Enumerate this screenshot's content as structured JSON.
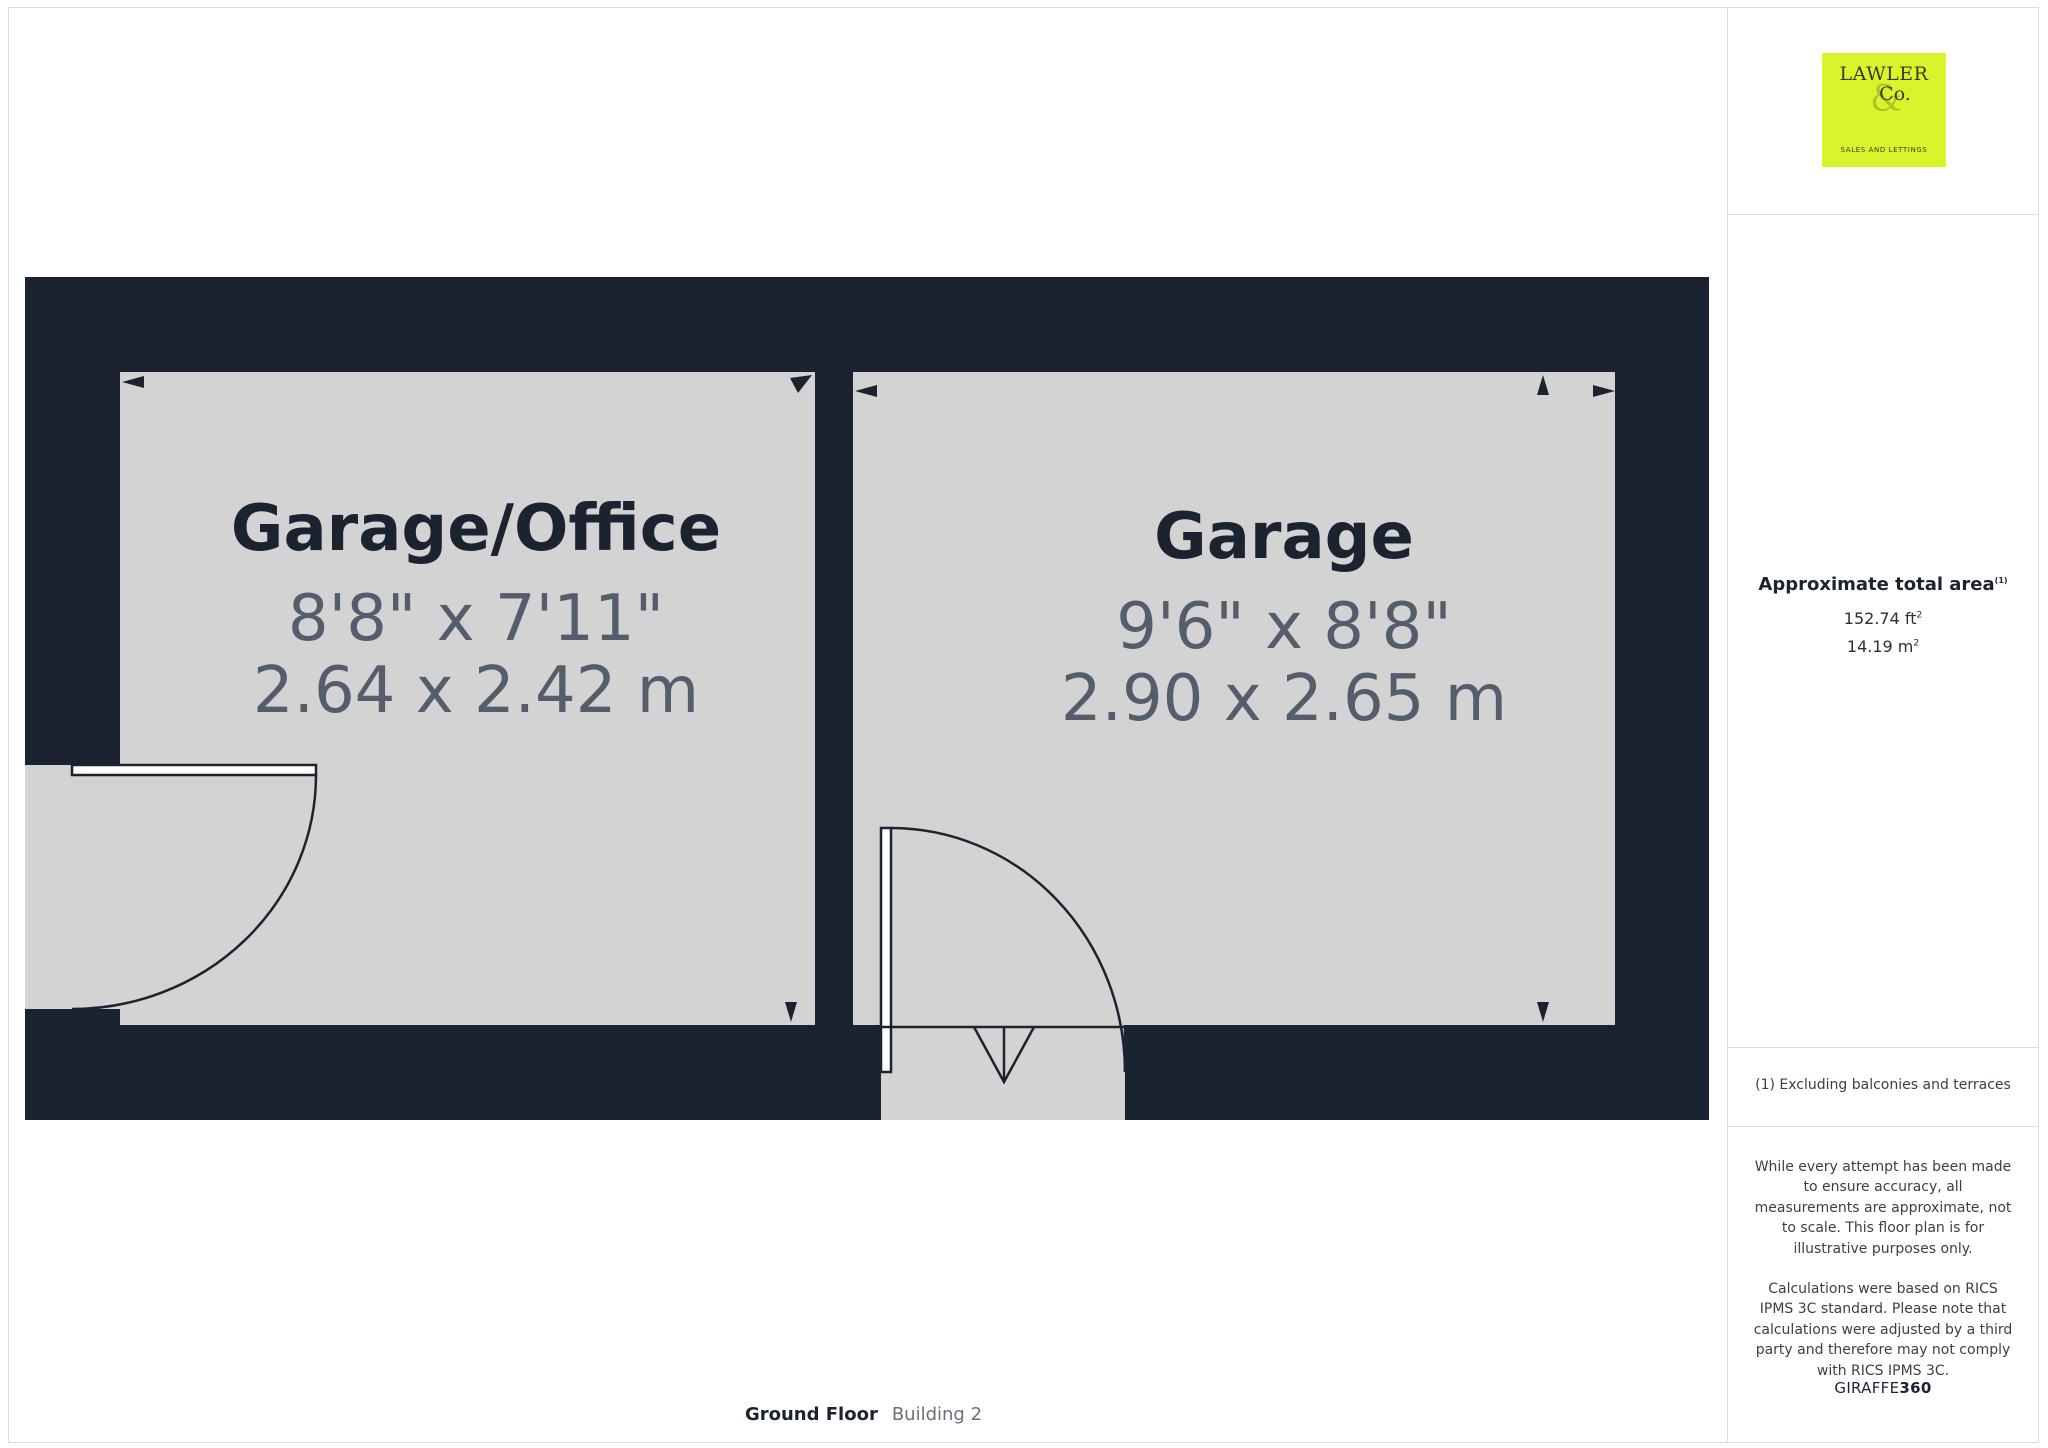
{
  "logo": {
    "line1": "LAWLER",
    "line2": "Co.",
    "ampersand": "&",
    "tagline": "SALES AND LETTINGS",
    "color": "#d8f52b"
  },
  "area": {
    "title": "Approximate total area",
    "title_note": "(1)",
    "sq_ft": "152.74 ft",
    "sq_m": "14.19 m",
    "sup": "2"
  },
  "footnote": "(1) Excluding balconies and terraces",
  "disclaimer": {
    "p1": "While every attempt has been made to ensure accuracy, all measurements are approximate, not to scale. This floor plan is for illustrative purposes only.",
    "p2": "Calculations were based on RICS IPMS 3C standard. Please note that calculations were adjusted by a third party and therefore may not comply with RICS IPMS 3C."
  },
  "brand": {
    "prefix": "GIRAFFE",
    "suffix": "360"
  },
  "floor": {
    "name": "Ground Floor",
    "building": "Building 2"
  },
  "rooms": [
    {
      "name": "Garage/Office",
      "dim_imperial": "8'8\" x 7'11\"",
      "dim_metric": "2.64 x 2.42 m"
    },
    {
      "name": "Garage",
      "dim_imperial": "9'6\" x 8'8\"",
      "dim_metric": "2.90 x 2.65 m"
    }
  ],
  "colors": {
    "wall": "#1c2330",
    "floor": "#d3d3d3"
  }
}
